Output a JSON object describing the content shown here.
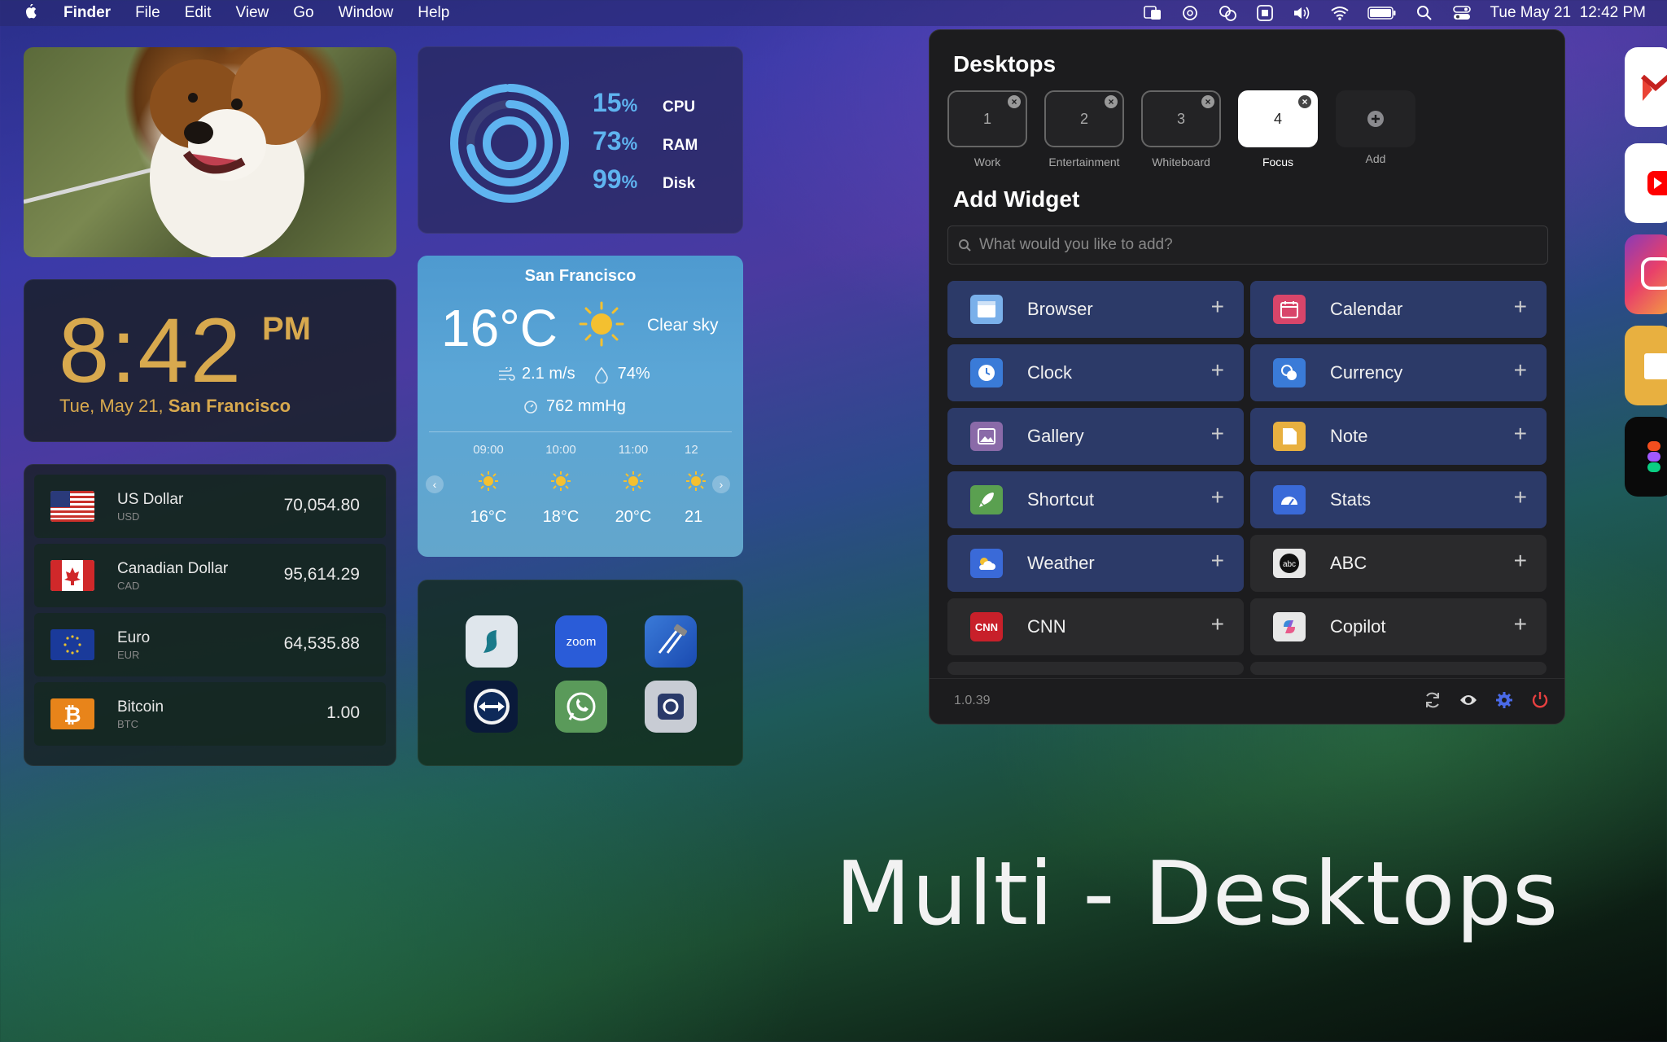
{
  "menubar": {
    "app": "Finder",
    "items": [
      "File",
      "Edit",
      "View",
      "Go",
      "Window",
      "Help"
    ],
    "datetime": "Tue May 21  12:42 PM"
  },
  "clock": {
    "time": "8:42",
    "ampm": "PM",
    "date": "Tue, May 21,",
    "city": "San Francisco",
    "color": "#d8a94e"
  },
  "currency": [
    {
      "name": "US Dollar",
      "code": "USD",
      "value": "70,054.80",
      "flag": "us-flag"
    },
    {
      "name": "Canadian Dollar",
      "code": "CAD",
      "value": "95,614.29",
      "flag": "ca-flag"
    },
    {
      "name": "Euro",
      "code": "EUR",
      "value": "64,535.88",
      "flag": "eu-flag"
    },
    {
      "name": "Bitcoin",
      "code": "BTC",
      "value": "1.00",
      "flag": "btc-icon"
    }
  ],
  "stats": [
    {
      "value": "15",
      "unit": "%",
      "label": "CPU"
    },
    {
      "value": "73",
      "unit": "%",
      "label": "RAM"
    },
    {
      "value": "99",
      "unit": "%",
      "label": "Disk"
    }
  ],
  "weather": {
    "city": "San Francisco",
    "temp": "16°C",
    "sky": "Clear sky",
    "wind": "2.1 m/s",
    "humidity": "74%",
    "pressure": "762 mmHg",
    "hours": [
      {
        "time": "09:00",
        "temp": "16°C"
      },
      {
        "time": "10:00",
        "temp": "18°C"
      },
      {
        "time": "11:00",
        "temp": "20°C"
      },
      {
        "time": "12",
        "temp": "21"
      }
    ]
  },
  "shortcuts": {
    "zoom_label": "zoom",
    "apps": [
      "surfshark-icon",
      "zoom-icon",
      "xcode-icon",
      "teamviewer-icon",
      "whatsapp-icon",
      "screenshot-icon"
    ]
  },
  "panel": {
    "desktops_title": "Desktops",
    "desktops": [
      {
        "num": "1",
        "label": "Work"
      },
      {
        "num": "2",
        "label": "Entertainment"
      },
      {
        "num": "3",
        "label": "Whiteboard"
      },
      {
        "num": "4",
        "label": "Focus",
        "active": true
      }
    ],
    "add_label": "Add",
    "add_widget_title": "Add Widget",
    "search_placeholder": "What would you like to add?",
    "widgets": [
      {
        "name": "Browser",
        "style": "blue",
        "icon": "browser-icon",
        "color": "#6ea8e8"
      },
      {
        "name": "Calendar",
        "style": "blue",
        "icon": "calendar-icon",
        "color": "#d8456a"
      },
      {
        "name": "Clock",
        "style": "blue",
        "icon": "clock-icon",
        "color": "#3a7bd8"
      },
      {
        "name": "Currency",
        "style": "blue",
        "icon": "currency-icon",
        "color": "#3a7bd8"
      },
      {
        "name": "Gallery",
        "style": "blue",
        "icon": "gallery-icon",
        "color": "#8a6aa8"
      },
      {
        "name": "Note",
        "style": "blue",
        "icon": "note-icon",
        "color": "#e8b040"
      },
      {
        "name": "Shortcut",
        "style": "blue",
        "icon": "shortcut-icon",
        "color": "#5aa050"
      },
      {
        "name": "Stats",
        "style": "blue",
        "icon": "stats-icon",
        "color": "#3a6ad8"
      },
      {
        "name": "Weather",
        "style": "blue",
        "icon": "weather-icon",
        "color": "#3a6ad8"
      },
      {
        "name": "ABC",
        "style": "gray",
        "icon": "abc-icon",
        "color": "#e8e8e8"
      },
      {
        "name": "CNN",
        "style": "gray",
        "icon": "cnn-icon",
        "color": "#c8202a"
      },
      {
        "name": "Copilot",
        "style": "gray",
        "icon": "copilot-icon",
        "color": "#e8e8e8"
      }
    ],
    "version": "1.0.39"
  },
  "tagline": "Multi - Desktops"
}
